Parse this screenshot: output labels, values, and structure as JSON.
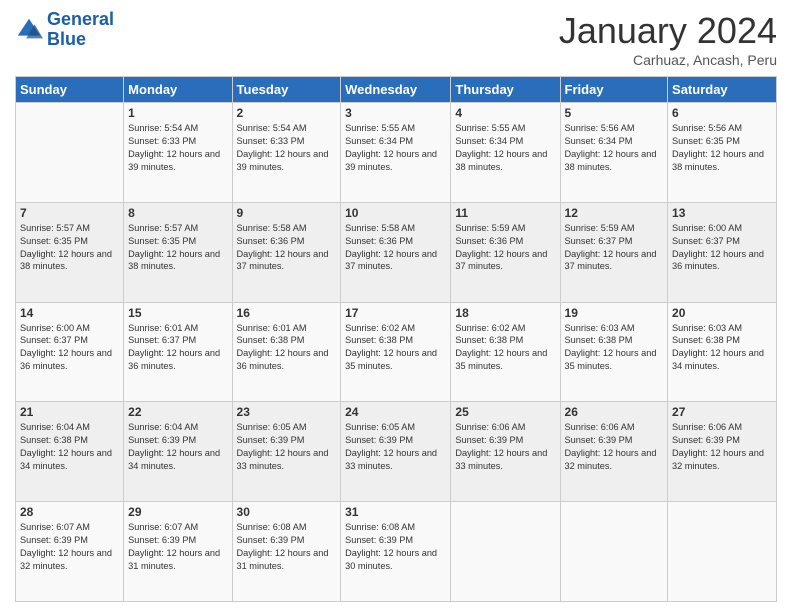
{
  "header": {
    "logo_line1": "General",
    "logo_line2": "Blue",
    "month": "January 2024",
    "location": "Carhuaz, Ancash, Peru"
  },
  "days_of_week": [
    "Sunday",
    "Monday",
    "Tuesday",
    "Wednesday",
    "Thursday",
    "Friday",
    "Saturday"
  ],
  "weeks": [
    [
      {
        "day": "",
        "sunrise": "",
        "sunset": "",
        "daylight": ""
      },
      {
        "day": "1",
        "sunrise": "Sunrise: 5:54 AM",
        "sunset": "Sunset: 6:33 PM",
        "daylight": "Daylight: 12 hours and 39 minutes."
      },
      {
        "day": "2",
        "sunrise": "Sunrise: 5:54 AM",
        "sunset": "Sunset: 6:33 PM",
        "daylight": "Daylight: 12 hours and 39 minutes."
      },
      {
        "day": "3",
        "sunrise": "Sunrise: 5:55 AM",
        "sunset": "Sunset: 6:34 PM",
        "daylight": "Daylight: 12 hours and 39 minutes."
      },
      {
        "day": "4",
        "sunrise": "Sunrise: 5:55 AM",
        "sunset": "Sunset: 6:34 PM",
        "daylight": "Daylight: 12 hours and 38 minutes."
      },
      {
        "day": "5",
        "sunrise": "Sunrise: 5:56 AM",
        "sunset": "Sunset: 6:34 PM",
        "daylight": "Daylight: 12 hours and 38 minutes."
      },
      {
        "day": "6",
        "sunrise": "Sunrise: 5:56 AM",
        "sunset": "Sunset: 6:35 PM",
        "daylight": "Daylight: 12 hours and 38 minutes."
      }
    ],
    [
      {
        "day": "7",
        "sunrise": "Sunrise: 5:57 AM",
        "sunset": "Sunset: 6:35 PM",
        "daylight": "Daylight: 12 hours and 38 minutes."
      },
      {
        "day": "8",
        "sunrise": "Sunrise: 5:57 AM",
        "sunset": "Sunset: 6:35 PM",
        "daylight": "Daylight: 12 hours and 38 minutes."
      },
      {
        "day": "9",
        "sunrise": "Sunrise: 5:58 AM",
        "sunset": "Sunset: 6:36 PM",
        "daylight": "Daylight: 12 hours and 37 minutes."
      },
      {
        "day": "10",
        "sunrise": "Sunrise: 5:58 AM",
        "sunset": "Sunset: 6:36 PM",
        "daylight": "Daylight: 12 hours and 37 minutes."
      },
      {
        "day": "11",
        "sunrise": "Sunrise: 5:59 AM",
        "sunset": "Sunset: 6:36 PM",
        "daylight": "Daylight: 12 hours and 37 minutes."
      },
      {
        "day": "12",
        "sunrise": "Sunrise: 5:59 AM",
        "sunset": "Sunset: 6:37 PM",
        "daylight": "Daylight: 12 hours and 37 minutes."
      },
      {
        "day": "13",
        "sunrise": "Sunrise: 6:00 AM",
        "sunset": "Sunset: 6:37 PM",
        "daylight": "Daylight: 12 hours and 36 minutes."
      }
    ],
    [
      {
        "day": "14",
        "sunrise": "Sunrise: 6:00 AM",
        "sunset": "Sunset: 6:37 PM",
        "daylight": "Daylight: 12 hours and 36 minutes."
      },
      {
        "day": "15",
        "sunrise": "Sunrise: 6:01 AM",
        "sunset": "Sunset: 6:37 PM",
        "daylight": "Daylight: 12 hours and 36 minutes."
      },
      {
        "day": "16",
        "sunrise": "Sunrise: 6:01 AM",
        "sunset": "Sunset: 6:38 PM",
        "daylight": "Daylight: 12 hours and 36 minutes."
      },
      {
        "day": "17",
        "sunrise": "Sunrise: 6:02 AM",
        "sunset": "Sunset: 6:38 PM",
        "daylight": "Daylight: 12 hours and 35 minutes."
      },
      {
        "day": "18",
        "sunrise": "Sunrise: 6:02 AM",
        "sunset": "Sunset: 6:38 PM",
        "daylight": "Daylight: 12 hours and 35 minutes."
      },
      {
        "day": "19",
        "sunrise": "Sunrise: 6:03 AM",
        "sunset": "Sunset: 6:38 PM",
        "daylight": "Daylight: 12 hours and 35 minutes."
      },
      {
        "day": "20",
        "sunrise": "Sunrise: 6:03 AM",
        "sunset": "Sunset: 6:38 PM",
        "daylight": "Daylight: 12 hours and 34 minutes."
      }
    ],
    [
      {
        "day": "21",
        "sunrise": "Sunrise: 6:04 AM",
        "sunset": "Sunset: 6:38 PM",
        "daylight": "Daylight: 12 hours and 34 minutes."
      },
      {
        "day": "22",
        "sunrise": "Sunrise: 6:04 AM",
        "sunset": "Sunset: 6:39 PM",
        "daylight": "Daylight: 12 hours and 34 minutes."
      },
      {
        "day": "23",
        "sunrise": "Sunrise: 6:05 AM",
        "sunset": "Sunset: 6:39 PM",
        "daylight": "Daylight: 12 hours and 33 minutes."
      },
      {
        "day": "24",
        "sunrise": "Sunrise: 6:05 AM",
        "sunset": "Sunset: 6:39 PM",
        "daylight": "Daylight: 12 hours and 33 minutes."
      },
      {
        "day": "25",
        "sunrise": "Sunrise: 6:06 AM",
        "sunset": "Sunset: 6:39 PM",
        "daylight": "Daylight: 12 hours and 33 minutes."
      },
      {
        "day": "26",
        "sunrise": "Sunrise: 6:06 AM",
        "sunset": "Sunset: 6:39 PM",
        "daylight": "Daylight: 12 hours and 32 minutes."
      },
      {
        "day": "27",
        "sunrise": "Sunrise: 6:06 AM",
        "sunset": "Sunset: 6:39 PM",
        "daylight": "Daylight: 12 hours and 32 minutes."
      }
    ],
    [
      {
        "day": "28",
        "sunrise": "Sunrise: 6:07 AM",
        "sunset": "Sunset: 6:39 PM",
        "daylight": "Daylight: 12 hours and 32 minutes."
      },
      {
        "day": "29",
        "sunrise": "Sunrise: 6:07 AM",
        "sunset": "Sunset: 6:39 PM",
        "daylight": "Daylight: 12 hours and 31 minutes."
      },
      {
        "day": "30",
        "sunrise": "Sunrise: 6:08 AM",
        "sunset": "Sunset: 6:39 PM",
        "daylight": "Daylight: 12 hours and 31 minutes."
      },
      {
        "day": "31",
        "sunrise": "Sunrise: 6:08 AM",
        "sunset": "Sunset: 6:39 PM",
        "daylight": "Daylight: 12 hours and 30 minutes."
      },
      {
        "day": "",
        "sunrise": "",
        "sunset": "",
        "daylight": ""
      },
      {
        "day": "",
        "sunrise": "",
        "sunset": "",
        "daylight": ""
      },
      {
        "day": "",
        "sunrise": "",
        "sunset": "",
        "daylight": ""
      }
    ]
  ]
}
